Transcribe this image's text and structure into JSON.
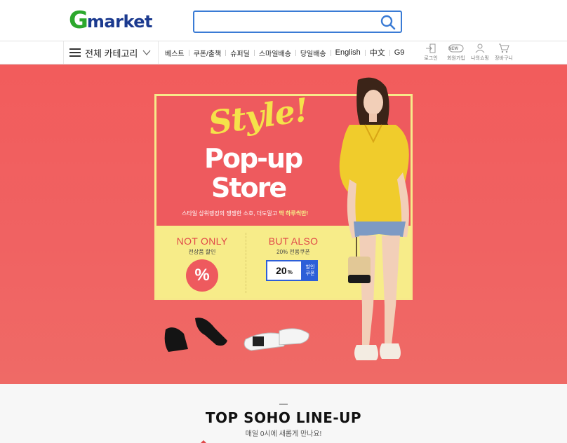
{
  "header": {
    "logo_g": "G",
    "logo_rest": "market",
    "search": {
      "placeholder": "",
      "value": ""
    }
  },
  "nav": {
    "category_label": "전체 카테고리",
    "links": [
      "베스트",
      "쿠폰/출책",
      "슈퍼딜",
      "스마일배송",
      "당일배송",
      "English",
      "中文",
      "G9"
    ],
    "utilities": [
      {
        "icon": "login-icon",
        "label": "로그인"
      },
      {
        "icon": "new-badge-icon",
        "label": "회원가입",
        "badge": "NEW"
      },
      {
        "icon": "person-icon",
        "label": "나의쇼핑"
      },
      {
        "icon": "cart-icon",
        "label": "장바구니"
      }
    ]
  },
  "banner": {
    "style_text": "Style!",
    "popup_text": "Pop-up",
    "store_text": "Store",
    "tagline_normal": "스타일 상위랭킹의 쟁쟁한 소호, 더도말고 ",
    "tagline_highlight": "딱 하루씩만!",
    "not_only": {
      "title": "NOT ONLY",
      "subtitle": "전상품 할인",
      "symbol": "%"
    },
    "but_also": {
      "title": "BUT ALSO",
      "subtitle": "20% 전용쿠폰",
      "coupon_value": "20",
      "coupon_unit": "%",
      "coupon_tag_1": "할인",
      "coupon_tag_2": "쿠폰"
    }
  },
  "section": {
    "title": "TOP SOHO LINE-UP",
    "subtitle": "매일 0시에 새롭게 만나요!"
  },
  "colors": {
    "banner_red": "#f06262",
    "panel_yellow": "#f7ec89",
    "logo_green": "#2ca82c",
    "logo_navy": "#1b3a8f",
    "accent_blue": "#2d5fd8",
    "highlight_yellow": "#f8e63a"
  }
}
